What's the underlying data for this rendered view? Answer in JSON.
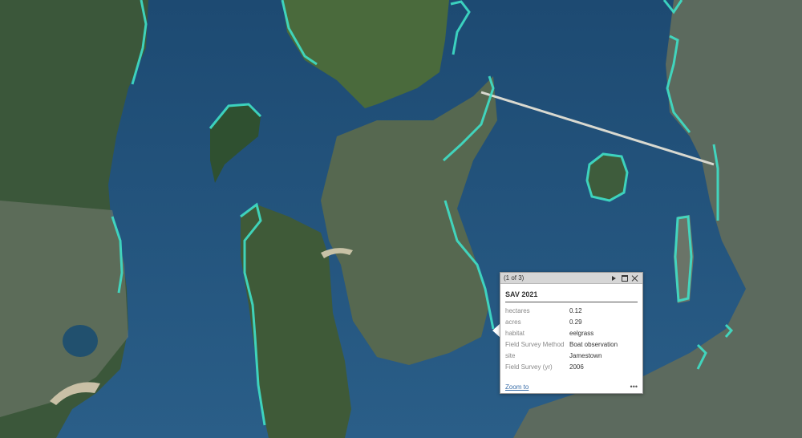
{
  "map": {
    "colors": {
      "water": "#22507a",
      "land": "#3a5a3a",
      "sav_outline": "#3fe0c8",
      "sav_fill": "#6fd27a"
    }
  },
  "popup": {
    "pager": "(1 of 3)",
    "title": "SAV 2021",
    "fields": [
      {
        "label": "hectares",
        "value": "0.12"
      },
      {
        "label": "acres",
        "value": "0.29"
      },
      {
        "label": "habitat",
        "value": "eelgrass"
      },
      {
        "label": "Field Survey Method",
        "value": "Boat observation"
      },
      {
        "label": "site",
        "value": "Jamestown"
      },
      {
        "label": "Field Survey (yr)",
        "value": "2006"
      }
    ],
    "zoom_label": "Zoom to",
    "more_label": "•••"
  }
}
